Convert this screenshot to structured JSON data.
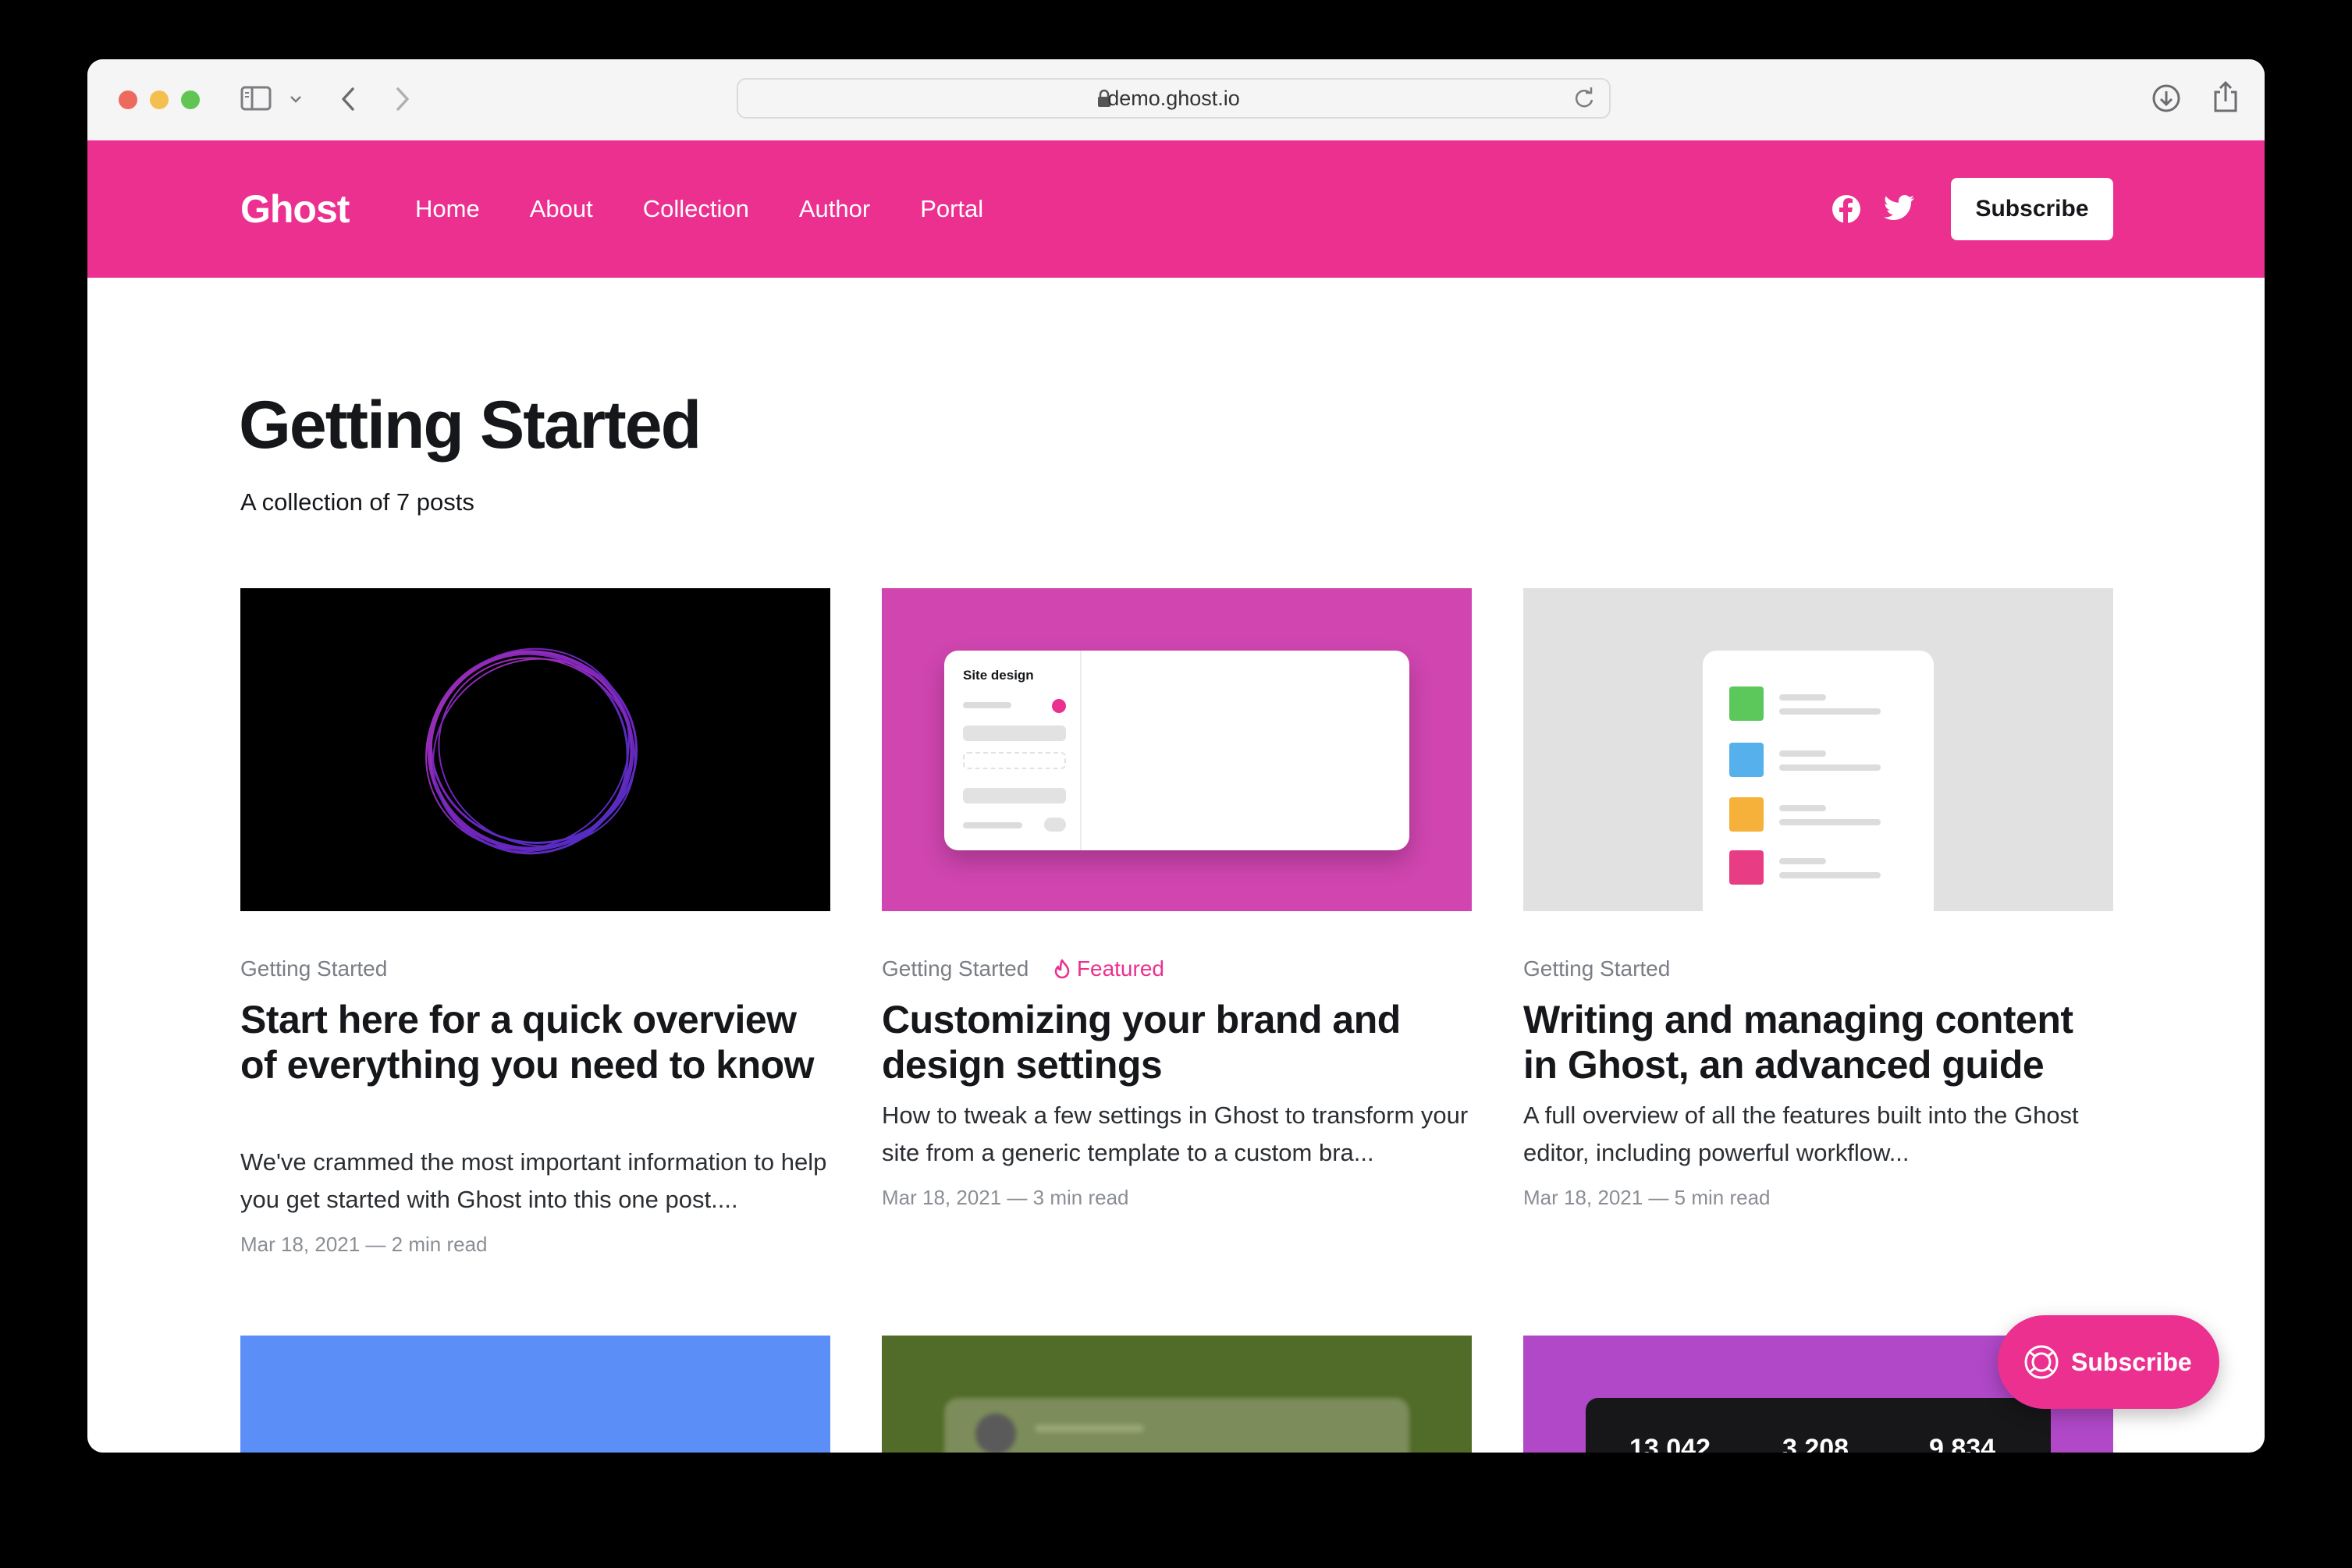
{
  "browser": {
    "url": "demo.ghost.io"
  },
  "site": {
    "logo": "Ghost",
    "accent": "#ec3090",
    "nav": [
      "Home",
      "About",
      "Collection",
      "Author",
      "Portal"
    ],
    "subscribe_label": "Subscribe"
  },
  "collection": {
    "title": "Getting Started",
    "description": "A collection of 7 posts"
  },
  "posts": [
    {
      "tag": "Getting Started",
      "title": "Start here for a quick overview of everything you need to know",
      "excerpt": "We've crammed the most important information to help you get started with Ghost into this one post....",
      "meta": "Mar 18, 2021 — 2 min read"
    },
    {
      "tag": "Getting Started",
      "featured": "Featured",
      "thumb_label": "Site design",
      "title": "Customizing your brand and design settings",
      "excerpt": "How to tweak a few settings in Ghost to transform your site from a generic template to a custom bra...",
      "meta": "Mar 18, 2021 — 3 min read"
    },
    {
      "tag": "Getting Started",
      "title": "Writing and managing content in Ghost, an advanced guide",
      "excerpt": "A full overview of all the features built into the Ghost editor, including powerful workflow...",
      "meta": "Mar 18, 2021 — 5 min read"
    }
  ],
  "next_row": {
    "stats": [
      "13,042",
      "3,208",
      "9,834"
    ]
  },
  "portal": {
    "label": "Subscribe"
  }
}
